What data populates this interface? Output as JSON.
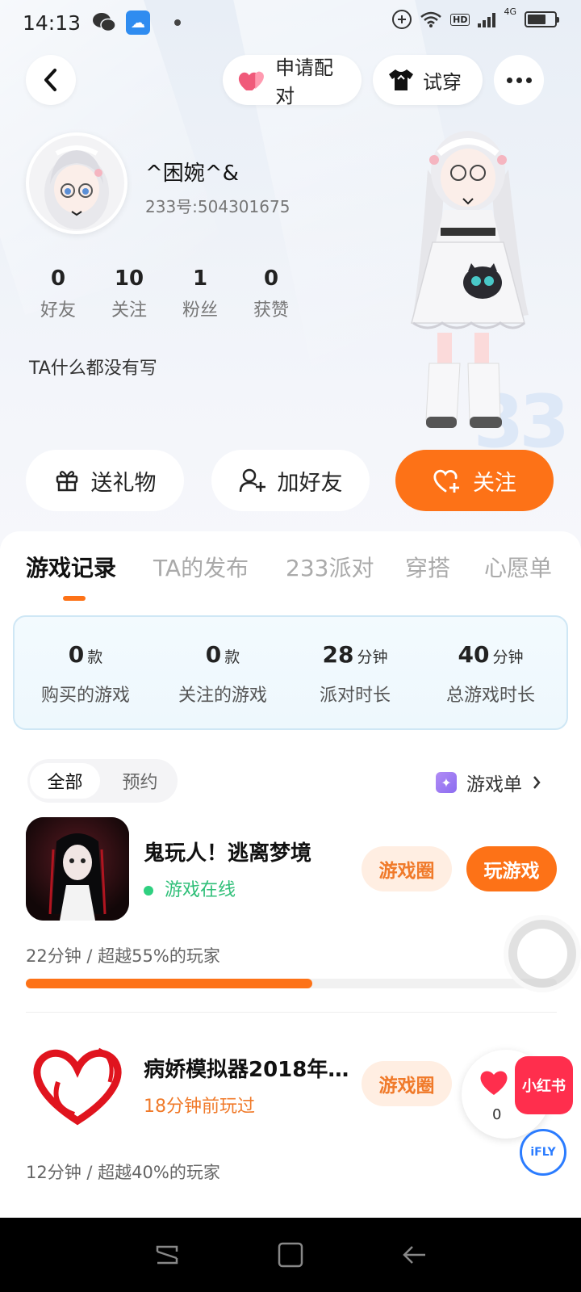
{
  "status_bar": {
    "time": "14:13",
    "network": "4G",
    "hd": "HD"
  },
  "header": {
    "pair_label": "申请配对",
    "try_label": "试穿"
  },
  "profile": {
    "name": "^困婉^&",
    "id": "233号:504301675",
    "stats": [
      {
        "value": "0",
        "label": "好友"
      },
      {
        "value": "10",
        "label": "关注"
      },
      {
        "value": "1",
        "label": "粉丝"
      },
      {
        "value": "0",
        "label": "获赞"
      }
    ],
    "bio": "TA什么都没有写"
  },
  "actions": {
    "gift": "送礼物",
    "add_friend": "加好友",
    "follow": "关注"
  },
  "tabs": [
    "游戏记录",
    "TA的发布",
    "233派对",
    "穿搭",
    "心愿单"
  ],
  "summary": [
    {
      "value": "0",
      "unit": "款",
      "label": "购买的游戏"
    },
    {
      "value": "0",
      "unit": "款",
      "label": "关注的游戏"
    },
    {
      "value": "28",
      "unit": "分钟",
      "label": "派对时长"
    },
    {
      "value": "40",
      "unit": "分钟",
      "label": "总游戏时长"
    }
  ],
  "filter": {
    "all": "全部",
    "reserve": "预约"
  },
  "gamelist_label": "游戏单",
  "games": [
    {
      "title": "鬼玩人！逃离梦境",
      "status": "游戏在线",
      "circle": "游戏圈",
      "play": "玩游戏",
      "meta": "22分钟 / 超越55%的玩家",
      "progress": 0.54
    },
    {
      "title": "病娇模拟器2018年…",
      "status": "18分钟前玩过",
      "circle": "游戏圈",
      "meta": "12分钟 / 超越40%的玩家"
    }
  ],
  "floating": {
    "like_count": "0",
    "xhs_label": "小红书",
    "ifly_label": "iFLY"
  },
  "colors": {
    "accent": "#fd7217",
    "online": "#2fd080"
  }
}
